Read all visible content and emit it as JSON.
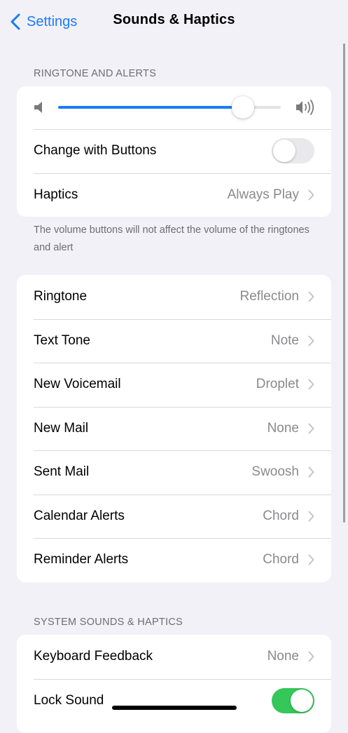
{
  "nav": {
    "back_label": "Settings",
    "title": "Sounds & Haptics"
  },
  "ringtone_section": {
    "header": "RINGTONE AND ALERTS",
    "volume_level": 0.83,
    "change_with_buttons": {
      "label": "Change with Buttons",
      "on": false
    },
    "haptics": {
      "label": "Haptics",
      "value": "Always Play"
    },
    "footer": "The volume buttons will not affect the volume of the ringtones and alert"
  },
  "tones": [
    {
      "label": "Ringtone",
      "value": "Reflection"
    },
    {
      "label": "Text Tone",
      "value": "Note"
    },
    {
      "label": "New Voicemail",
      "value": "Droplet"
    },
    {
      "label": "New Mail",
      "value": "None"
    },
    {
      "label": "Sent Mail",
      "value": "Swoosh"
    },
    {
      "label": "Calendar Alerts",
      "value": "Chord"
    },
    {
      "label": "Reminder Alerts",
      "value": "Chord"
    }
  ],
  "system_section": {
    "header": "SYSTEM SOUNDS & HAPTICS",
    "keyboard_feedback": {
      "label": "Keyboard Feedback",
      "value": "None"
    },
    "lock_sound": {
      "label": "Lock Sound",
      "on": true
    }
  },
  "colors": {
    "accent": "#1a7cf5",
    "toggle_on": "#34c759",
    "background": "#f2f1f7"
  }
}
